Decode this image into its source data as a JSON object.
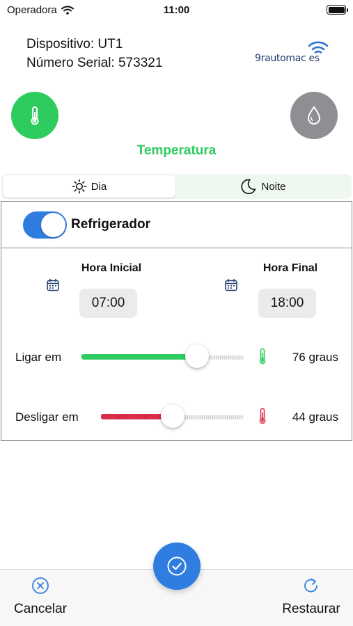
{
  "status_bar": {
    "carrier": "Operadora",
    "time": "11:00"
  },
  "device": {
    "name_line": "Dispositivo: UT1",
    "serial_line": "Número Serial: 573321"
  },
  "logo": {
    "text": "9rautomac  es"
  },
  "modes": {
    "active_label": "Temperatura"
  },
  "segments": {
    "day": "Dia",
    "night": "Noite",
    "selected": "Dia"
  },
  "panel": {
    "toggle_label": "Refrigerador",
    "toggle_on": true,
    "start_header": "Hora Inicial",
    "end_header": "Hora Final",
    "start_time": "07:00",
    "end_time": "18:00",
    "on_label": "Ligar em",
    "on_value": "76 graus",
    "on_level": 0.75,
    "off_label": "Desligar em",
    "off_value": "44 graus",
    "off_level": 0.5
  },
  "bottom_bar": {
    "cancel": "Cancelar",
    "restore": "Restaurar"
  },
  "colors": {
    "green": "#2ecc5f",
    "blue": "#2f7de1",
    "red": "#e0314b",
    "gray": "#8e8e93"
  }
}
